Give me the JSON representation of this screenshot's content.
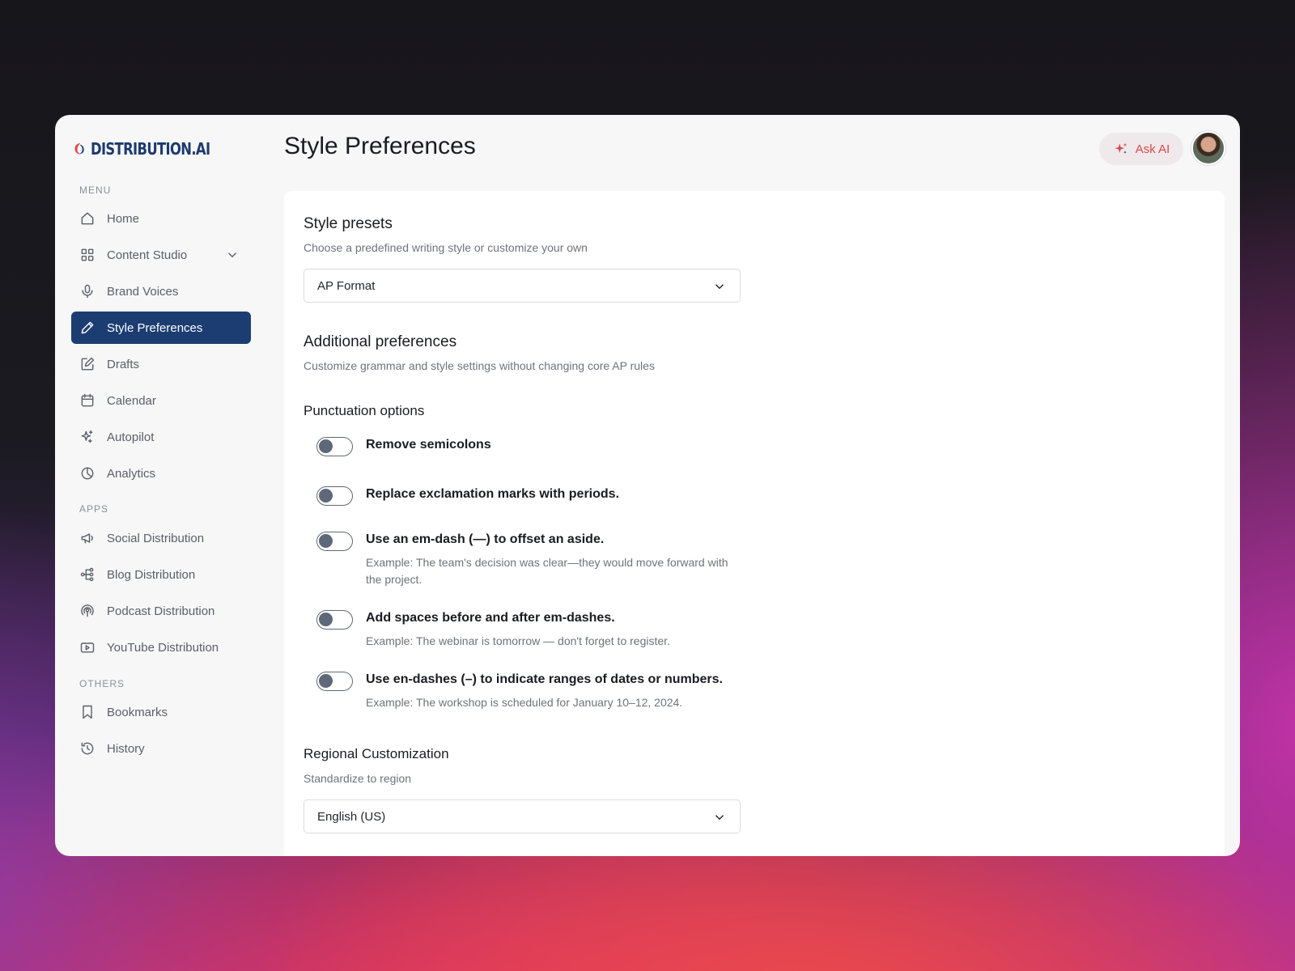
{
  "brand": {
    "name": "DISTRIBUTION.AI"
  },
  "header": {
    "title": "Style Preferences",
    "ask_ai_label": "Ask AI"
  },
  "sidebar": {
    "sections": {
      "menu": "MENU",
      "apps": "APPS",
      "others": "OTHERS"
    },
    "menu_items": [
      {
        "label": "Home",
        "icon": "home-icon"
      },
      {
        "label": "Content Studio",
        "icon": "grid-icon",
        "expandable": true
      },
      {
        "label": "Brand Voices",
        "icon": "microphone-icon"
      },
      {
        "label": "Style Preferences",
        "icon": "pencil-icon",
        "active": true
      },
      {
        "label": "Drafts",
        "icon": "edit-icon"
      },
      {
        "label": "Calendar",
        "icon": "calendar-icon"
      },
      {
        "label": "Autopilot",
        "icon": "sparkles-icon"
      },
      {
        "label": "Analytics",
        "icon": "pie-chart-icon"
      }
    ],
    "app_items": [
      {
        "label": "Social Distribution",
        "icon": "megaphone-icon"
      },
      {
        "label": "Blog Distribution",
        "icon": "share-icon"
      },
      {
        "label": "Podcast Distribution",
        "icon": "podcast-icon"
      },
      {
        "label": "YouTube Distribution",
        "icon": "youtube-icon"
      }
    ],
    "other_items": [
      {
        "label": "Bookmarks",
        "icon": "bookmark-icon"
      },
      {
        "label": "History",
        "icon": "history-icon"
      }
    ]
  },
  "presets": {
    "title": "Style presets",
    "subtitle": "Choose a predefined writing style or customize your own",
    "selected": "AP Format"
  },
  "additional": {
    "title": "Additional preferences",
    "subtitle": "Customize grammar and style settings without changing core AP rules"
  },
  "punctuation": {
    "title": "Punctuation options",
    "options": [
      {
        "label": "Remove semicolons",
        "example": "",
        "enabled": false
      },
      {
        "label": "Replace exclamation marks with periods.",
        "example": "",
        "enabled": false
      },
      {
        "label": "Use an em-dash (—) to offset an aside.",
        "example": "Example: The team's decision was clear—they would move forward with the project.",
        "enabled": false
      },
      {
        "label": "Add spaces before and after em-dashes.",
        "example": "Example: The webinar is tomorrow — don't forget to register.",
        "enabled": false
      },
      {
        "label": "Use en-dashes (–) to indicate ranges of dates or numbers.",
        "example": "Example: The workshop is scheduled for January 10–12, 2024.",
        "enabled": false
      }
    ]
  },
  "regional": {
    "title": "Regional Customization",
    "subtitle": "Standardize to region",
    "selected": "English (US)"
  },
  "colors": {
    "accent": "#1b3d72",
    "brand": "#1d3a6e",
    "ask_ai": "#d9474c"
  }
}
